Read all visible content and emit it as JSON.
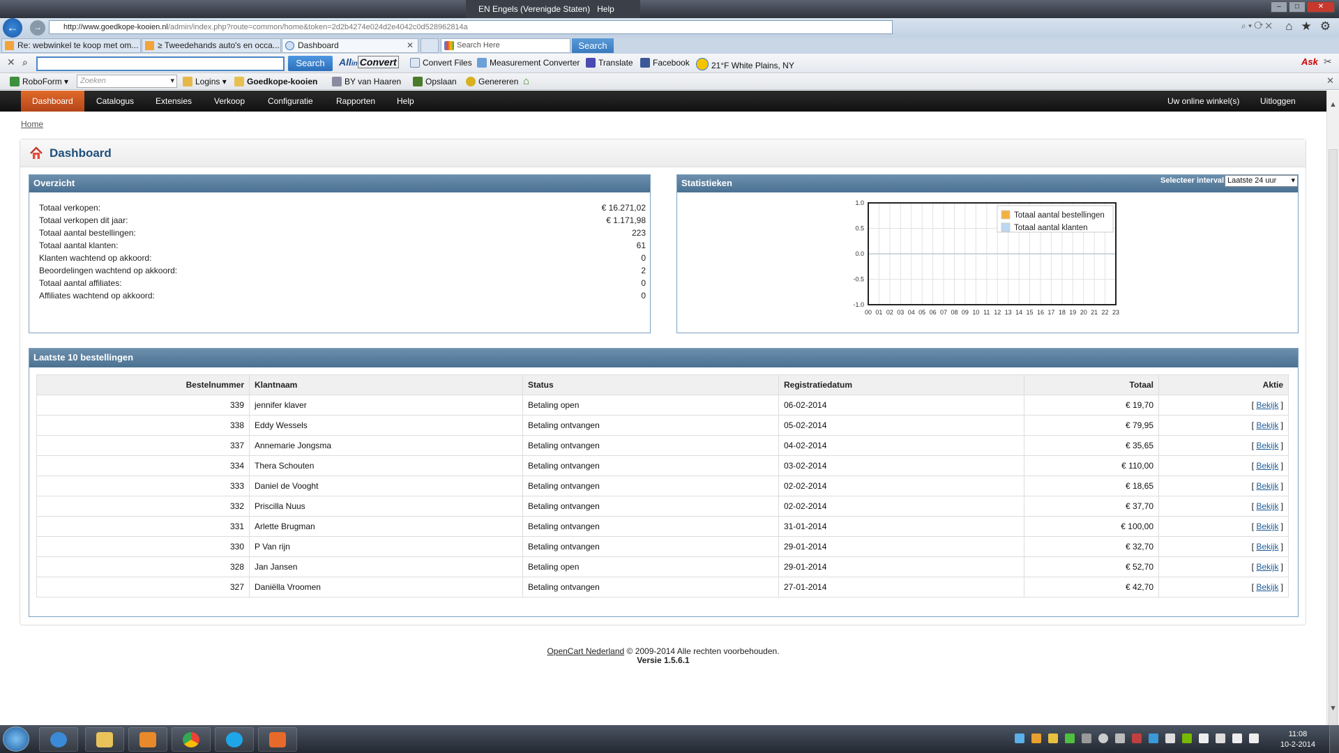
{
  "browser": {
    "address_host": "http://www.goedkope-kooien.nl",
    "address_path": "/admin/index.php?route=common/home&token=2d2b4274e024d2e4042c0d528962814a",
    "language_bar": "EN Engels (Verenigde Staten)",
    "help_label": "Help",
    "tabs": [
      {
        "label": "Re: webwinkel te koop met om..."
      },
      {
        "label": "≥ Tweedehands auto's en occa..."
      },
      {
        "label": "Dashboard"
      }
    ],
    "search_tab_placeholder": "Search Here",
    "search_tab_button": "Search",
    "toolbar": {
      "search_button": "Search",
      "allinone_prefix": "All",
      "allinone_mid": "in",
      "allinone_suffix": "Convert",
      "convert_files": "Convert Files",
      "measurement": "Measurement Converter",
      "translate": "Translate",
      "facebook": "Facebook",
      "weather": "21°F White Plains, NY"
    },
    "bookmarks": {
      "roboform": "RoboForm",
      "zoeken_placeholder": "Zoeken",
      "logins": "Logins",
      "goedkope": "Goedkope-kooien",
      "by": "BY van Haaren",
      "opslaan": "Opslaan",
      "genereren": "Genereren"
    }
  },
  "menu": {
    "items": [
      "Dashboard",
      "Catalogus",
      "Extensies",
      "Verkoop",
      "Configuratie",
      "Rapporten",
      "Help"
    ],
    "right": [
      "Uw online winkel(s)",
      "Uitloggen"
    ]
  },
  "breadcrumb": "Home",
  "page_title": "Dashboard",
  "overview": {
    "title": "Overzicht",
    "rows": [
      {
        "label": "Totaal verkopen:",
        "value": "€ 16.271,02"
      },
      {
        "label": "Totaal verkopen dit jaar:",
        "value": "€ 1.171,98"
      },
      {
        "label": "Totaal aantal bestellingen:",
        "value": "223"
      },
      {
        "label": "Totaal aantal klanten:",
        "value": "61"
      },
      {
        "label": "Klanten wachtend op akkoord:",
        "value": "0"
      },
      {
        "label": "Beoordelingen wachtend op akkoord:",
        "value": "2"
      },
      {
        "label": "Totaal aantal affiliates:",
        "value": "0"
      },
      {
        "label": "Affiliates wachtend op akkoord:",
        "value": "0"
      }
    ]
  },
  "statistics": {
    "title": "Statistieken",
    "interval_label": "Selecteer interval:",
    "interval_value": "Laatste 24 uur"
  },
  "chart_data": {
    "type": "line",
    "x": [
      "00",
      "01",
      "02",
      "03",
      "04",
      "05",
      "06",
      "07",
      "08",
      "09",
      "10",
      "11",
      "12",
      "13",
      "14",
      "15",
      "16",
      "17",
      "18",
      "19",
      "20",
      "21",
      "22",
      "23"
    ],
    "yticks": [
      "1.0",
      "0.5",
      "0.0",
      "-0.5",
      "-1.0"
    ],
    "ylim": [
      -1,
      1
    ],
    "grid": true,
    "legend_position": "top-right",
    "series": [
      {
        "name": "Totaal aantal bestellingen",
        "color": "#f4b13d",
        "values": [
          0,
          0,
          0,
          0,
          0,
          0,
          0,
          0,
          0,
          0,
          0,
          0,
          0,
          0,
          0,
          0,
          0,
          0,
          0,
          0,
          0,
          0,
          0,
          0
        ]
      },
      {
        "name": "Totaal aantal klanten",
        "color": "#bcd7f2",
        "values": [
          0,
          0,
          0,
          0,
          0,
          0,
          0,
          0,
          0,
          0,
          0,
          0,
          0,
          0,
          0,
          0,
          0,
          0,
          0,
          0,
          0,
          0,
          0,
          0
        ]
      }
    ]
  },
  "orders": {
    "title": "Laatste 10 bestellingen",
    "headers": [
      "Bestelnummer",
      "Klantnaam",
      "Status",
      "Registratiedatum",
      "Totaal",
      "Aktie"
    ],
    "rows": [
      [
        "339",
        "jennifer klaver",
        "Betaling open",
        "06-02-2014",
        "€ 19,70",
        "Bekijk"
      ],
      [
        "338",
        "Eddy Wessels",
        "Betaling ontvangen",
        "05-02-2014",
        "€ 79,95",
        "Bekijk"
      ],
      [
        "337",
        "Annemarie Jongsma",
        "Betaling ontvangen",
        "04-02-2014",
        "€ 35,65",
        "Bekijk"
      ],
      [
        "334",
        "Thera Schouten",
        "Betaling ontvangen",
        "03-02-2014",
        "€ 110,00",
        "Bekijk"
      ],
      [
        "333",
        "Daniel de Vooght",
        "Betaling ontvangen",
        "02-02-2014",
        "€ 18,65",
        "Bekijk"
      ],
      [
        "332",
        "Priscilla Nuus",
        "Betaling ontvangen",
        "02-02-2014",
        "€ 37,70",
        "Bekijk"
      ],
      [
        "331",
        "Arlette Brugman",
        "Betaling ontvangen",
        "31-01-2014",
        "€ 100,00",
        "Bekijk"
      ],
      [
        "330",
        "P Van rijn",
        "Betaling ontvangen",
        "29-01-2014",
        "€ 32,70",
        "Bekijk"
      ],
      [
        "328",
        "Jan Jansen",
        "Betaling open",
        "29-01-2014",
        "€ 52,70",
        "Bekijk"
      ],
      [
        "327",
        "Daniëlla Vroomen",
        "Betaling ontvangen",
        "27-01-2014",
        "€ 42,70",
        "Bekijk"
      ]
    ]
  },
  "footer": {
    "link": "OpenCart Nederland",
    "text": " © 2009-2014 Alle rechten voorbehouden.",
    "version": "Versie 1.5.6.1"
  },
  "taskbar": {
    "time": "11:08",
    "date": "10-2-2014"
  }
}
